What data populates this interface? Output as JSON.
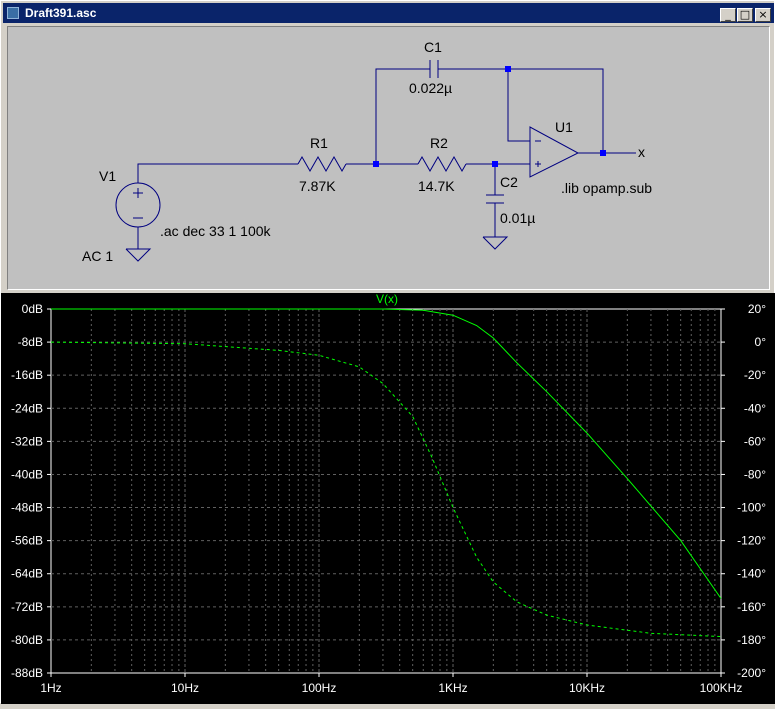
{
  "window": {
    "title": "Draft391.asc",
    "buttons": {
      "minimize": "_",
      "maximize": "□",
      "close": "×"
    }
  },
  "schematic": {
    "labels": {
      "c1_name": "C1",
      "c1_value": "0.022µ",
      "u1_name": "U1",
      "r1_name": "R1",
      "r1_value": "7.87K",
      "r2_name": "R2",
      "r2_value": "14.7K",
      "c2_name": "C2",
      "c2_value": "0.01µ",
      "v1_name": "V1",
      "v1_value": "AC 1",
      "output_net": "x",
      "ac_directive": ".ac dec 33 1 100k",
      "lib_directive": ".lib opamp.sub"
    }
  },
  "plot": {
    "trace_label": "V(x)",
    "colors": {
      "background": "#000000",
      "trace": "#00ff00",
      "text": "#ffffff",
      "grid": "#606060"
    },
    "chart_data": {
      "type": "line",
      "title": "V(x)",
      "xscale": "log",
      "x_ticks": [
        "1Hz",
        "10Hz",
        "100Hz",
        "1KHz",
        "10KHz",
        "100KHz"
      ],
      "y_left_ticks": [
        "0dB",
        "-8dB",
        "-16dB",
        "-24dB",
        "-32dB",
        "-40dB",
        "-48dB",
        "-56dB",
        "-64dB",
        "-72dB",
        "-80dB",
        "-88dB"
      ],
      "y_right_ticks": [
        "20°",
        "0°",
        "-20°",
        "-40°",
        "-60°",
        "-80°",
        "-100°",
        "-120°",
        "-140°",
        "-160°",
        "-180°",
        "-200°"
      ],
      "xlim": [
        1,
        100000
      ],
      "ylim_left": [
        -88,
        0
      ],
      "ylim_right": [
        -200,
        20
      ],
      "grid": true,
      "series": [
        {
          "axis": "left",
          "style": "solid",
          "x": [
            1,
            10,
            100,
            300,
            600,
            1000,
            1500,
            2000,
            3000,
            5000,
            10000,
            20000,
            50000,
            100000
          ],
          "values": [
            0,
            0,
            0,
            0,
            -0.3,
            -1.5,
            -4,
            -7,
            -13,
            -20,
            -30,
            -41,
            -56,
            -70
          ]
        },
        {
          "axis": "right",
          "style": "dashed",
          "x": [
            1,
            10,
            50,
            100,
            200,
            300,
            500,
            700,
            1000,
            1500,
            2000,
            3000,
            5000,
            10000,
            30000,
            100000
          ],
          "values": [
            0,
            -1,
            -5,
            -8,
            -15,
            -25,
            -45,
            -70,
            -100,
            -130,
            -145,
            -157,
            -165,
            -171,
            -176,
            -178
          ]
        }
      ]
    }
  }
}
